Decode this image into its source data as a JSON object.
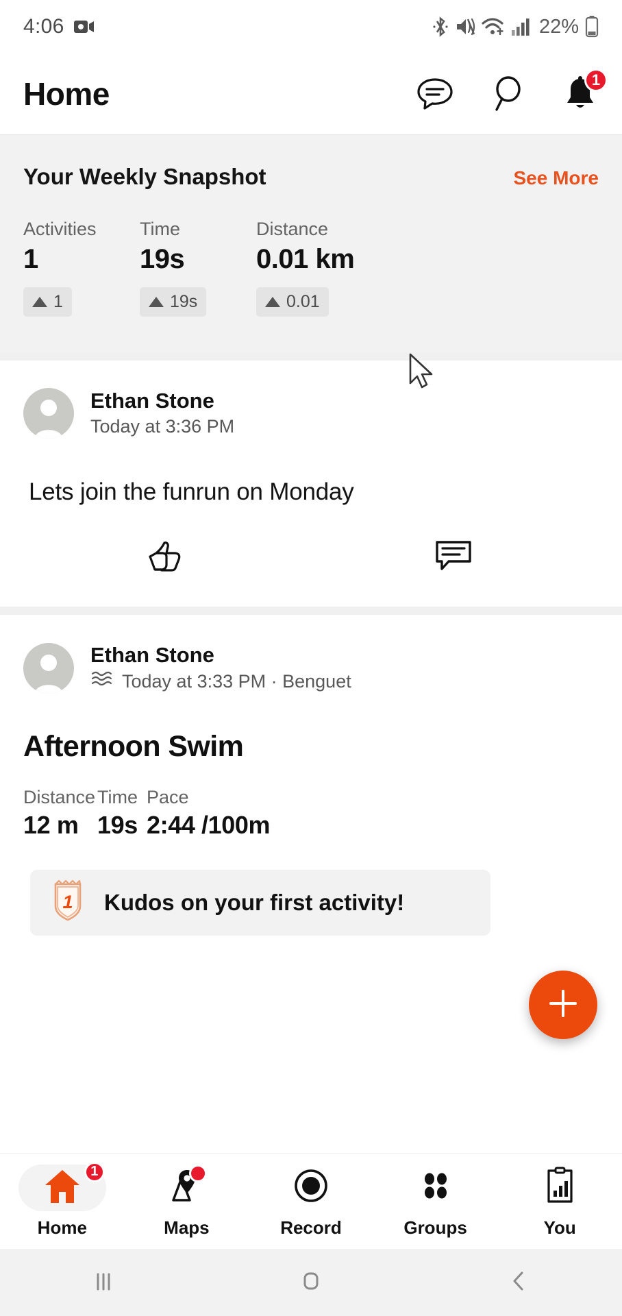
{
  "status_bar": {
    "time": "4:06",
    "battery_percent": "22%",
    "icons": [
      "screen-recorder-icon",
      "bluetooth-icon",
      "vibrate-icon",
      "wifi-icon",
      "cellular-signal-icon",
      "battery-icon"
    ]
  },
  "header": {
    "title": "Home",
    "messages_icon": "chat-bubble-icon",
    "search_icon": "search-icon",
    "notifications_icon": "bell-icon",
    "notifications_badge": "1"
  },
  "snapshot": {
    "title": "Your Weekly Snapshot",
    "see_more_label": "See More",
    "accent_color": "#e8521f",
    "stats": [
      {
        "label": "Activities",
        "value": "1",
        "delta": "1"
      },
      {
        "label": "Time",
        "value": "19s",
        "delta": "19s"
      },
      {
        "label": "Distance",
        "value": "0.01 km",
        "delta": "0.01"
      }
    ]
  },
  "feed": {
    "post": {
      "author": "Ethan Stone",
      "timestamp": "Today at 3:36 PM",
      "body": "Lets join the funrun on Monday",
      "kudos_icon": "thumbs-up-icon",
      "comment_icon": "comment-icon"
    },
    "activity": {
      "author": "Ethan Stone",
      "sport_icon": "swim-waves-icon",
      "timestamp": "Today at 3:33 PM · Benguet",
      "title": "Afternoon Swim",
      "stats": [
        {
          "label": "Distance",
          "value": "12 m"
        },
        {
          "label": "Time",
          "value": "19s"
        },
        {
          "label": "Pace",
          "value": "2:44 /100m"
        }
      ],
      "achievement": {
        "badge_icon": "first-activity-shield-icon",
        "badge_number": "1",
        "text": "Kudos on your first activity!"
      }
    }
  },
  "fab": {
    "icon": "plus-icon",
    "color": "#ec4a0d"
  },
  "bottom_nav": {
    "items": [
      {
        "label": "Home",
        "icon": "home-icon",
        "active": true,
        "badge": "1"
      },
      {
        "label": "Maps",
        "icon": "map-pin-icon",
        "active": false,
        "dot": true
      },
      {
        "label": "Record",
        "icon": "record-icon",
        "active": false
      },
      {
        "label": "Groups",
        "icon": "groups-icon",
        "active": false
      },
      {
        "label": "You",
        "icon": "clipboard-icon",
        "active": false
      }
    ]
  },
  "system_nav": {
    "recents_icon": "recents-icon",
    "home_icon": "home-square-icon",
    "back_icon": "back-chevron-icon"
  }
}
